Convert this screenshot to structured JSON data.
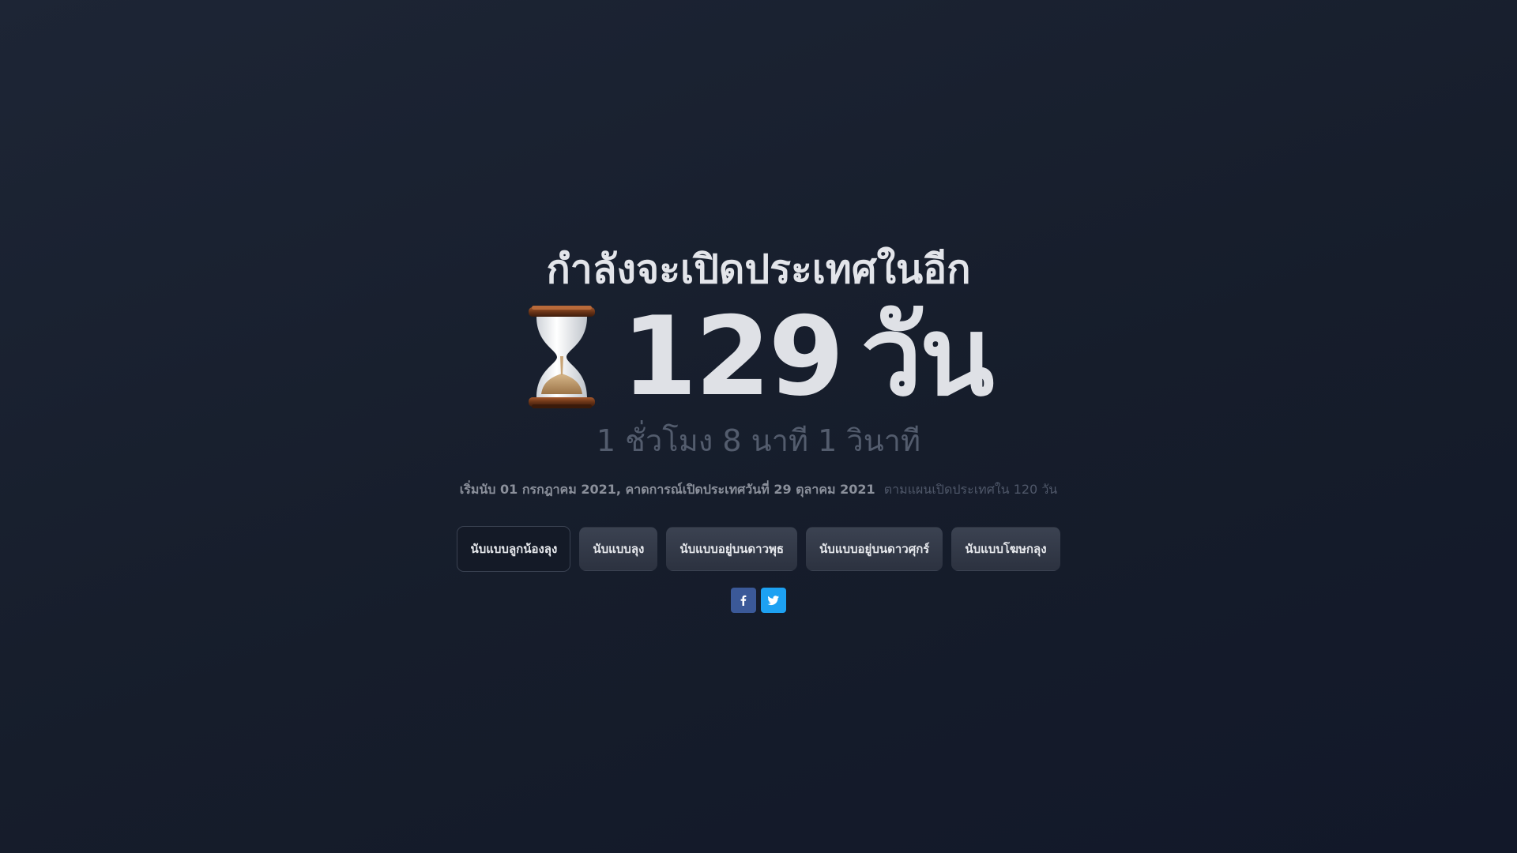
{
  "headline": "กำลังจะเปิดประเทศในอีก",
  "countdown": {
    "icon": "hourglass-icon",
    "days_number": "129",
    "days_unit": "วัน",
    "remaining": "1 ชั่วโมง 8 นาที 1 วินาที"
  },
  "info": {
    "main": "เริ่มนับ 01 กรกฎาคม 2021, คาดการณ์เปิดประเทศวันที่ 29 ตุลาคม 2021",
    "note": "ตามแผนเปิดประเทศใน 120 วัน"
  },
  "modes": [
    {
      "label": "นับแบบลูกน้องลุง",
      "active": true
    },
    {
      "label": "นับแบบลุง",
      "active": false
    },
    {
      "label": "นับแบบอยู่บนดาวพุธ",
      "active": false
    },
    {
      "label": "นับแบบอยู่บนดาวศุกร์",
      "active": false
    },
    {
      "label": "นับแบบโฆษกลุง",
      "active": false
    }
  ],
  "social": [
    {
      "icon": "facebook-icon",
      "color": "#3b5998"
    },
    {
      "icon": "twitter-icon",
      "color": "#1da1f2"
    }
  ],
  "colors": {
    "background": "#1a2130",
    "headline": "#e3e5ea",
    "muted": "#535c6d",
    "button": "#353b49"
  }
}
